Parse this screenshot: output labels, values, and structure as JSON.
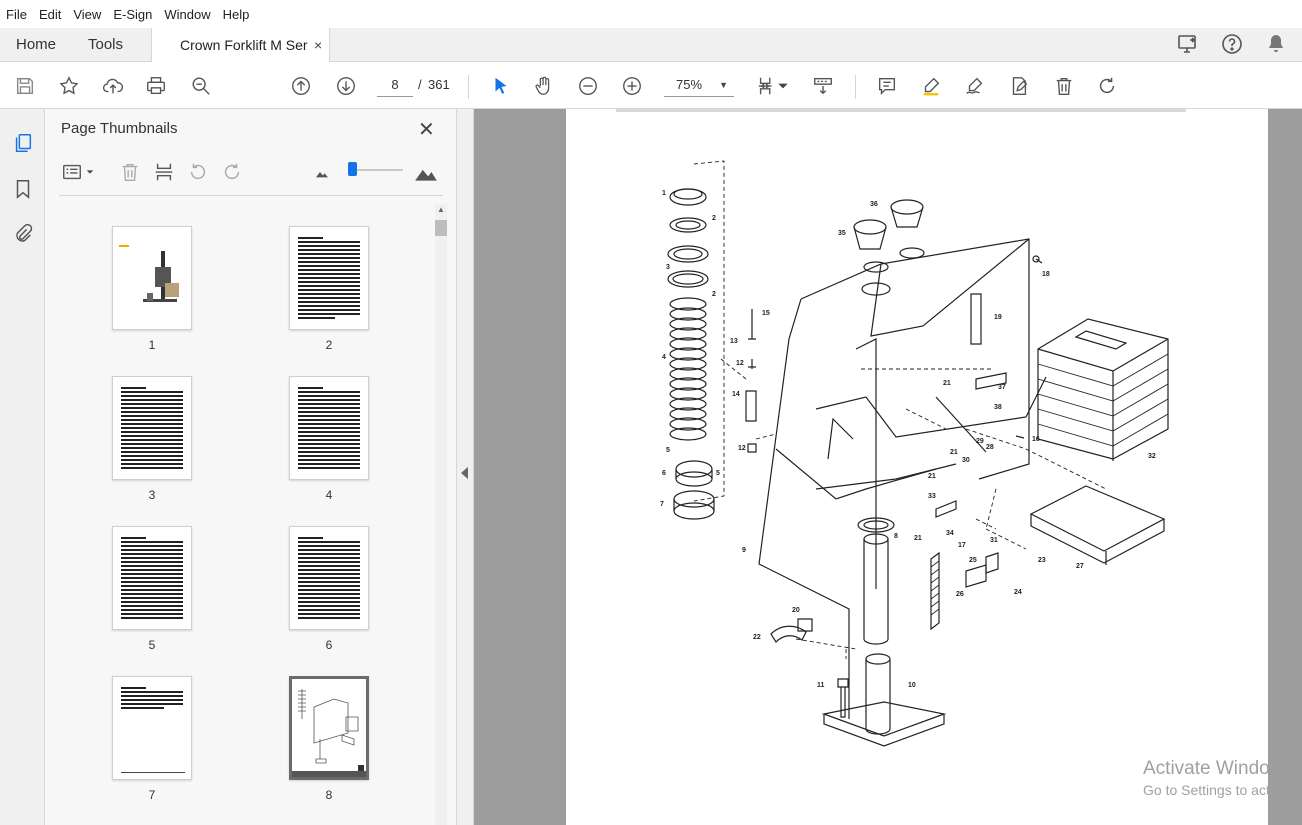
{
  "menu": [
    "File",
    "Edit",
    "View",
    "E-Sign",
    "Window",
    "Help"
  ],
  "tabs": {
    "home": "Home",
    "tools": "Tools",
    "document": "Crown Forklift M Series Parts Manual",
    "close": "×"
  },
  "toolbar": {
    "current_page": "8",
    "page_separator": "/",
    "total_pages": "361",
    "zoom": "75%"
  },
  "panel": {
    "title": "Page Thumbnails",
    "close": "✕"
  },
  "thumbnails": [
    {
      "label": "1",
      "kind": "cover"
    },
    {
      "label": "2",
      "kind": "toc"
    },
    {
      "label": "3",
      "kind": "toc"
    },
    {
      "label": "4",
      "kind": "toc"
    },
    {
      "label": "5",
      "kind": "toc"
    },
    {
      "label": "6",
      "kind": "toc"
    },
    {
      "label": "7",
      "kind": "toc-short"
    },
    {
      "label": "8",
      "kind": "drawing",
      "selected": true
    }
  ],
  "callouts": [
    "1",
    "2",
    "3",
    "2",
    "4",
    "5",
    "6",
    "5",
    "7",
    "9",
    "35",
    "36",
    "15",
    "13",
    "12",
    "14",
    "12",
    "18",
    "19",
    "21",
    "37",
    "38",
    "16",
    "29",
    "28",
    "21",
    "30",
    "21",
    "33",
    "34",
    "21",
    "17",
    "31",
    "32",
    "25",
    "23",
    "24",
    "26",
    "27",
    "8",
    "20",
    "22",
    "11",
    "10"
  ],
  "watermark": {
    "line1": "Activate Windows",
    "line2": "Go to Settings to activate"
  }
}
